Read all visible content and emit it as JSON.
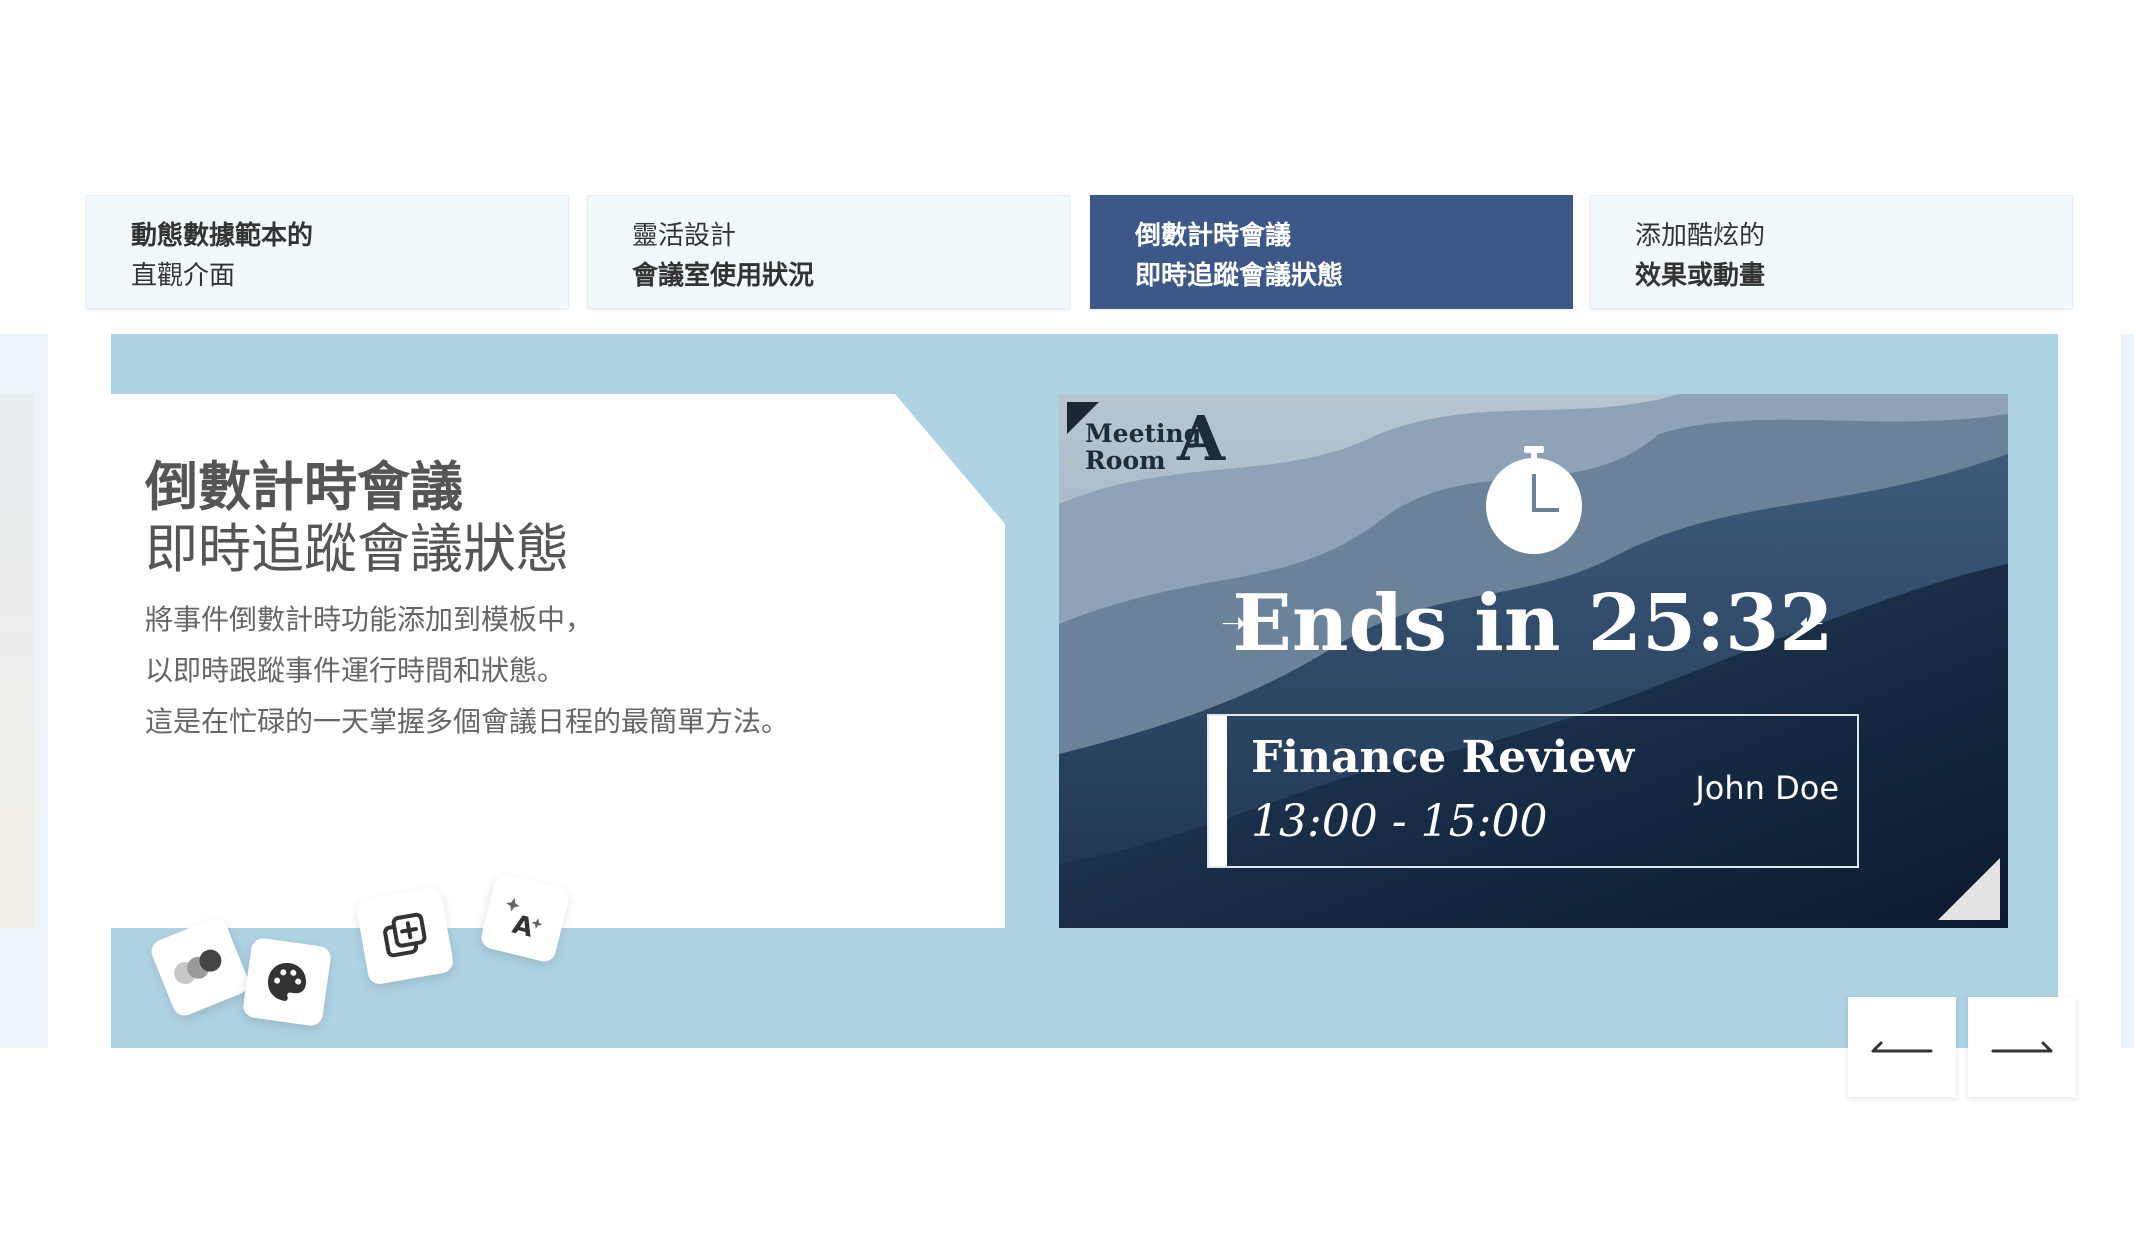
{
  "tabs": [
    {
      "line1": "動態數據範本的",
      "line2": "直觀介面",
      "active": false
    },
    {
      "line1": "靈活設計",
      "line2": "會議室使用狀況",
      "active": false
    },
    {
      "line1": "倒數計時會議",
      "line2": "即時追蹤會議狀態",
      "active": true
    },
    {
      "line1": "添加酷炫的",
      "line2": "效果或動畫",
      "active": false
    }
  ],
  "card": {
    "title": "倒數計時會議",
    "subtitle": "即時追蹤會議狀態",
    "body": [
      "將事件倒數計時功能添加到模板中，",
      "以即時跟蹤事件運行時間和狀態。",
      "這是在忙碌的一天掌握多個會議日程的最簡單方法。"
    ]
  },
  "preview": {
    "room_label_line1": "Meeting",
    "room_label_line2": "Room",
    "room_letter": "A",
    "countdown_text": "Ends in 25:32",
    "meeting_title": "Finance Review",
    "meeting_time": "13:00 - 15:00",
    "host": "John Doe"
  },
  "icons": {
    "feature_chips": [
      "toggle-dots-icon",
      "palette-icon",
      "add-copy-icon",
      "ai-text-icon"
    ],
    "prev": "arrow-left-icon",
    "next": "arrow-right-icon"
  },
  "colors": {
    "active_tab": "#3d5888",
    "stage": "#aed3e3",
    "tab_bg": "#f1f9fc"
  }
}
